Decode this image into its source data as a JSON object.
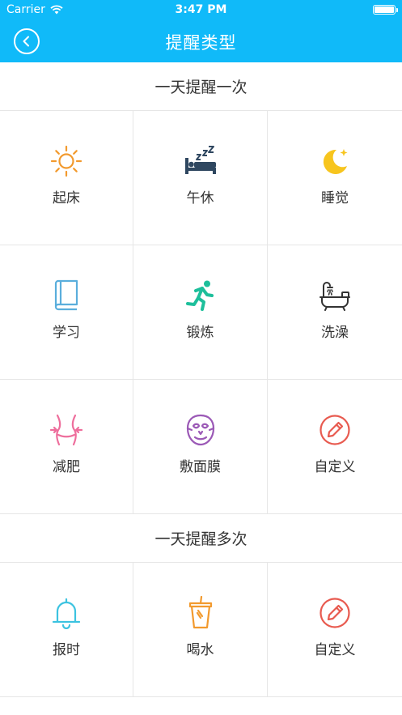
{
  "status_bar": {
    "carrier": "Carrier",
    "time": "3:47 PM"
  },
  "nav": {
    "title": "提醒类型",
    "back_icon": "chevron-left-circle-icon"
  },
  "colors": {
    "header_blue": "#10BAF9",
    "divider": "#e6e6e6"
  },
  "sections": [
    {
      "title": "一天提醒一次",
      "items": [
        {
          "label": "起床",
          "icon": "sun-icon",
          "color": "#F29A2E"
        },
        {
          "label": "午休",
          "icon": "sleep-bed-icon",
          "color": "#2F4760"
        },
        {
          "label": "睡觉",
          "icon": "moon-icon",
          "color": "#F7C51E"
        },
        {
          "label": "学习",
          "icon": "book-icon",
          "color": "#5AAEDC"
        },
        {
          "label": "锻炼",
          "icon": "running-icon",
          "color": "#1DBF9B"
        },
        {
          "label": "洗澡",
          "icon": "bathtub-icon",
          "color": "#333333"
        },
        {
          "label": "减肥",
          "icon": "waist-icon",
          "color": "#EE6E9C"
        },
        {
          "label": "敷面膜",
          "icon": "face-mask-icon",
          "color": "#9B59B6"
        },
        {
          "label": "自定义",
          "icon": "pencil-circle-icon",
          "color": "#E85A4F"
        }
      ]
    },
    {
      "title": "一天提醒多次",
      "items": [
        {
          "label": "报时",
          "icon": "bell-icon",
          "color": "#3CC3E0"
        },
        {
          "label": "喝水",
          "icon": "drink-cup-icon",
          "color": "#F29A2E"
        },
        {
          "label": "自定义",
          "icon": "pencil-circle-icon",
          "color": "#E85A4F"
        }
      ]
    }
  ]
}
